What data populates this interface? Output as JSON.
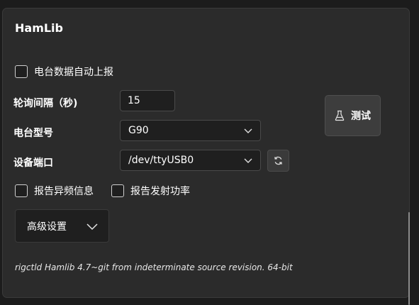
{
  "panel": {
    "title": "HamLib",
    "auto_report": {
      "label": "电台数据自动上报",
      "checked": false
    },
    "poll_interval": {
      "label": "轮询间隔（秒)",
      "value": "15"
    },
    "radio_model": {
      "label": "电台型号",
      "value": "G90"
    },
    "device_port": {
      "label": "设备端口",
      "value": "/dev/ttyUSB0"
    },
    "report_abnormal_freq": {
      "label": "报告异频信息",
      "checked": false
    },
    "report_tx_power": {
      "label": "报告发射功率",
      "checked": false
    },
    "test_button": {
      "label": "测试"
    },
    "advanced_settings": {
      "label": "高级设置"
    },
    "version_info": "rigctld Hamlib 4.7~git from indeterminate source revision. 64-bit"
  },
  "icons": {
    "test": "flask-icon",
    "refresh": "refresh-icon",
    "dropdown": "chevron-down-icon"
  },
  "colors": {
    "background": "#1c1c1c",
    "panel": "#2b2b2b",
    "input": "#1f1f1f",
    "button": "#3d3d3d",
    "text": "#ffffff"
  }
}
